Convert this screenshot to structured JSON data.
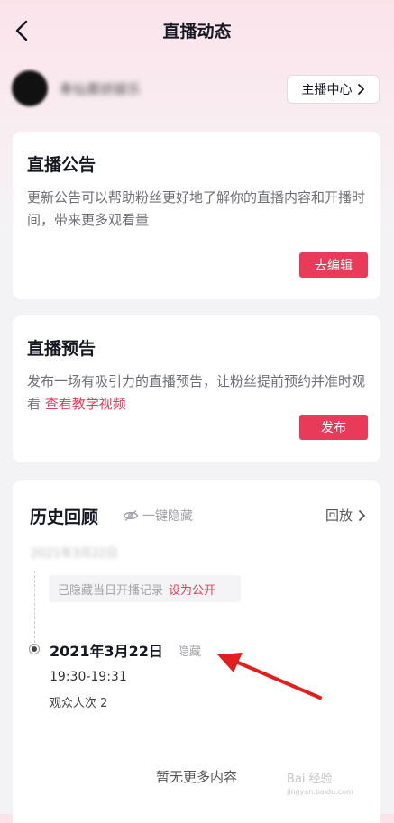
{
  "nav": {
    "title": "直播动态",
    "back_icon": "chevron-left-icon"
  },
  "profile": {
    "username": "奉仙慕妍娱乐",
    "host_center_label": "主播中心",
    "host_center_icon": "chevron-right-icon"
  },
  "announcement": {
    "title": "直播公告",
    "desc": "更新公告可以帮助粉丝更好地了解你的直播内容和开播时间，带来更多观看量",
    "button": "去编辑"
  },
  "preview": {
    "title": "直播预告",
    "desc": "发布一场有吸引力的直播预告，让粉丝提前预约并准时观看",
    "link": "查看教学视频",
    "button": "发布"
  },
  "history": {
    "title": "历史回顾",
    "hide_all": "一键隐藏",
    "replay": "回放",
    "blurred_date": "2021年3月22日",
    "hidden_notice": "已隐藏当日开播记录",
    "make_public": "设为公开",
    "entry": {
      "date": "2021年3月22日",
      "hide_label": "隐藏",
      "time": "19:30-19:31",
      "viewers": "观众人次 2"
    },
    "no_more": "暂无更多内容"
  },
  "watermark": {
    "line1": "Bai 经验",
    "line2": "jingyan.baidu.com"
  },
  "colors": {
    "accent": "#e93a5a",
    "arrow": "#e02020"
  }
}
